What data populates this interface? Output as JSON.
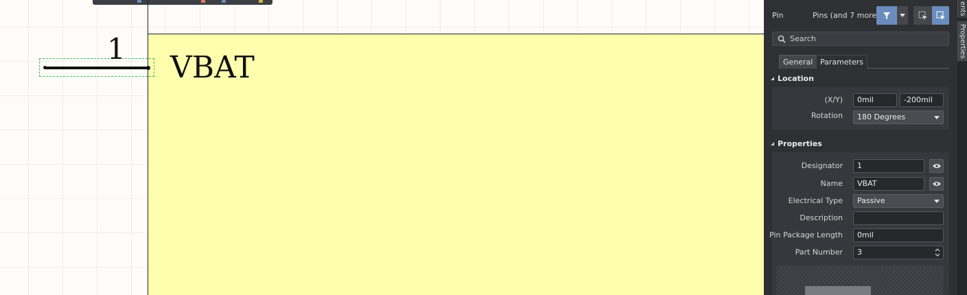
{
  "canvas": {
    "pin": {
      "designator_display": "1",
      "name_display": "VBAT"
    },
    "colors": {
      "sheet_background": "#fdfcf8",
      "part_body_fill": "#fffeae",
      "pin_color": "#111111",
      "selection_color": "#36c24a"
    }
  },
  "panel": {
    "kind": "Pin",
    "filter_text": "Pins (and 7 more)",
    "search": {
      "placeholder": "Search"
    },
    "tabs": [
      "General",
      "Parameters"
    ],
    "location": {
      "title": "Location",
      "xy_label": "(X/Y)",
      "x_value": "0mil",
      "y_value": "-200mil",
      "rotation_label": "Rotation",
      "rotation_value": "180 Degrees"
    },
    "properties": {
      "title": "Properties",
      "designator_label": "Designator",
      "designator_value": "1",
      "name_label": "Name",
      "name_value": "VBAT",
      "electrical_type_label": "Electrical Type",
      "electrical_type_value": "Passive",
      "description_label": "Description",
      "description_value": "",
      "pin_package_length_label": "Pin Package Length",
      "pin_package_length_value": "0mil",
      "part_number_label": "Part Number",
      "part_number_value": "3"
    },
    "colors": {
      "background": "#2f3034",
      "accent": "#6a8dbd"
    }
  },
  "side_tabs": [
    "ents",
    "Properties"
  ]
}
